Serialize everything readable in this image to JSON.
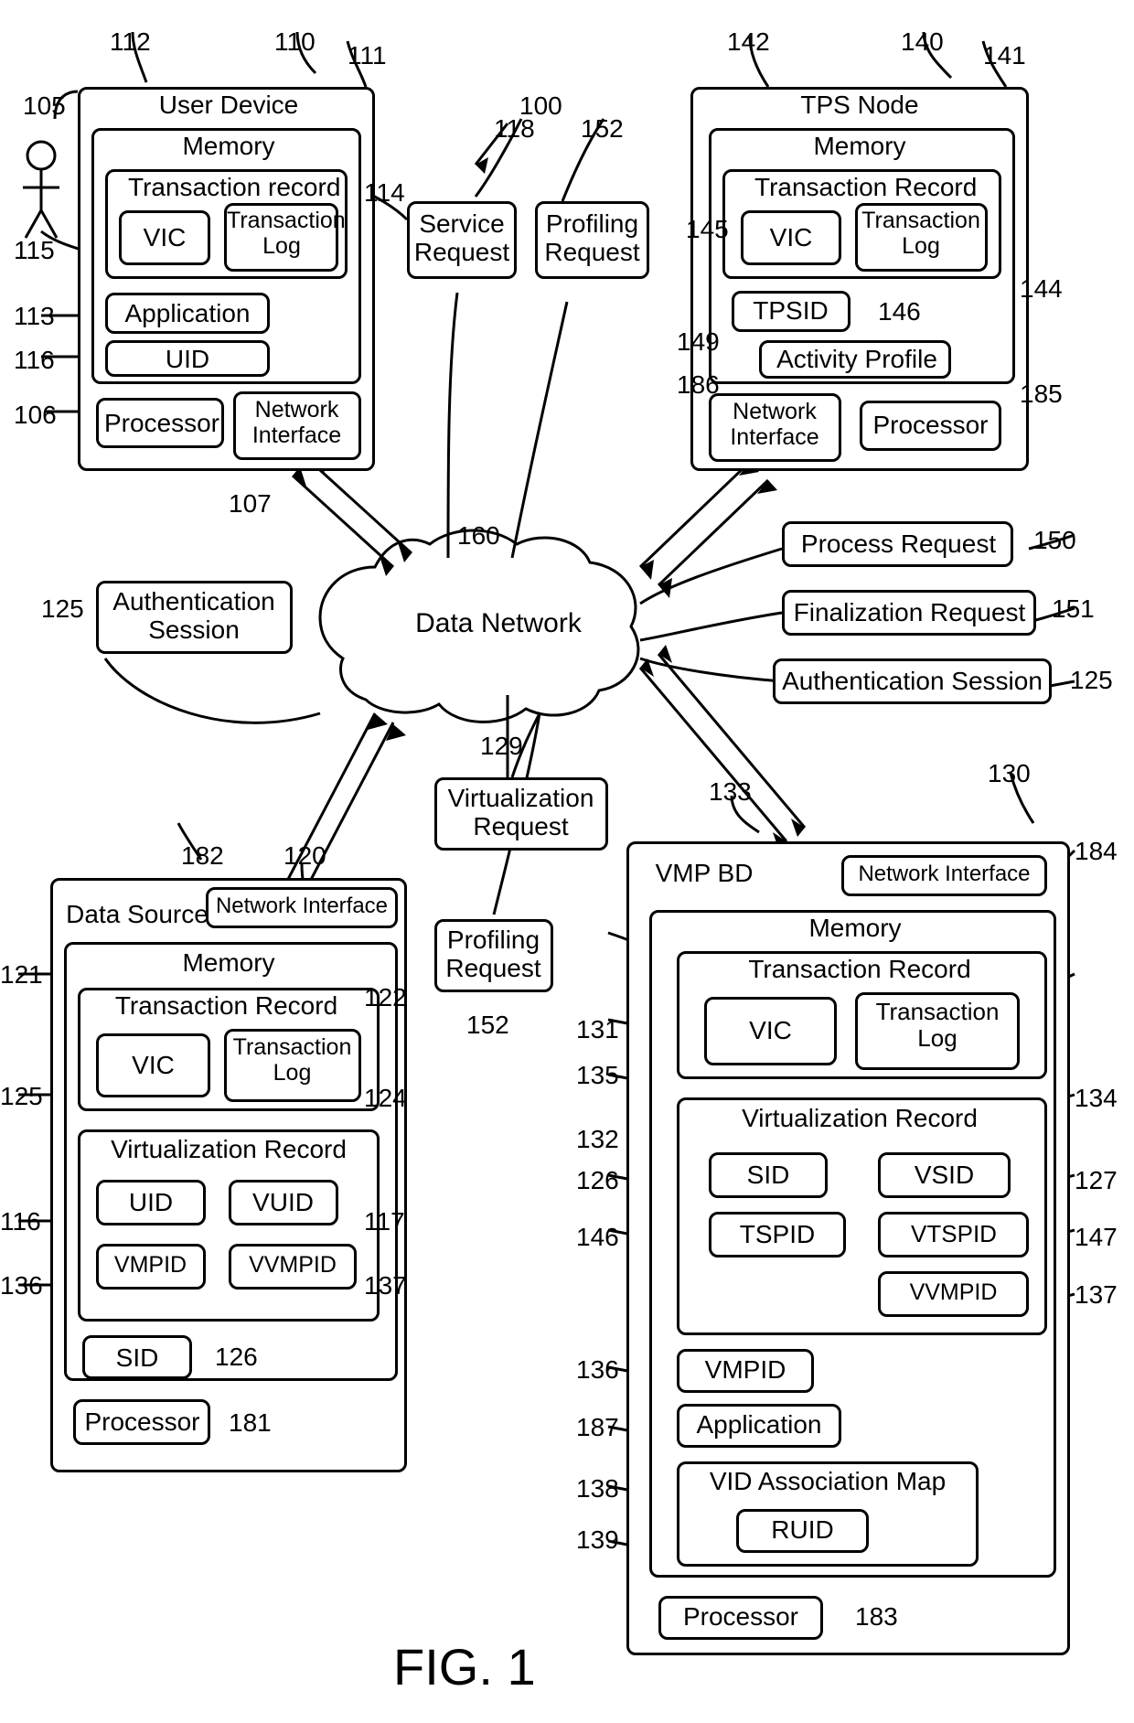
{
  "figure_label": "FIG. 1",
  "user_device": {
    "title": "User Device",
    "memory": "Memory",
    "tr": "Transaction record",
    "vic": "VIC",
    "tlog": "Transaction\nLog",
    "app": "Application",
    "uid": "UID",
    "proc": "Processor",
    "netif": "Network\nInterface"
  },
  "tps_node": {
    "title": "TPS Node",
    "memory": "Memory",
    "tr": "Transaction Record",
    "vic": "VIC",
    "tlog": "Transaction\nLog",
    "tpsid": "TPSID",
    "activity": "Activity Profile",
    "netif": "Network\nInterface",
    "proc": "Processor"
  },
  "data_source": {
    "title": "Data Source",
    "netif": "Network Interface",
    "memory": "Memory",
    "tr": "Transaction Record",
    "vic": "VIC",
    "tlog": "Transaction\nLog",
    "vr": "Virtualization Record",
    "uid": "UID",
    "vuid": "VUID",
    "vmpid": "VMPID",
    "vvmpid": "VVMPID",
    "sid": "SID",
    "proc": "Processor"
  },
  "vmp_bd": {
    "title": "VMP BD",
    "netif": "Network Interface",
    "memory": "Memory",
    "tr": "Transaction Record",
    "vic": "VIC",
    "tlog": "Transaction\nLog",
    "vr": "Virtualization Record",
    "sid": "SID",
    "vsid": "VSID",
    "tspid": "TSPID",
    "vtspid": "VTSPID",
    "vvmpid": "VVMPID",
    "vmpid": "VMPID",
    "app": "Application",
    "vidmap": "VID Association Map",
    "ruid": "RUID",
    "proc": "Processor"
  },
  "free": {
    "service_req": "Service\nRequest",
    "profiling_req": "Profiling\nRequest",
    "data_network": "Data Network",
    "auth_session": "Authentication\nSession",
    "virt_req": "Virtualization\nRequest",
    "profiling_req2": "Profiling\nRequest",
    "process_req": "Process Request",
    "final_req": "Finalization Request",
    "auth_session2": "Authentication Session"
  },
  "refs": {
    "r100": "100",
    "r105": "105",
    "r106": "106",
    "r107": "107",
    "r110": "110",
    "r111": "111",
    "r112": "112",
    "r113": "113",
    "r114": "114",
    "r115": "115",
    "r116": "116",
    "r117": "117",
    "r118": "118",
    "r120": "120",
    "r121": "121",
    "r122": "122",
    "r124": "124",
    "r125": "125",
    "r125b": "125",
    "r125c": "125",
    "r126": "126",
    "r126b": "126",
    "r127": "127",
    "r129": "129",
    "r130": "130",
    "r131": "131",
    "r132": "132",
    "r133": "133",
    "r134": "134",
    "r135": "135",
    "r136": "136",
    "r136b": "136",
    "r137": "137",
    "r137b": "137",
    "r138": "138",
    "r139": "139",
    "r140": "140",
    "r141": "141",
    "r142": "142",
    "r144": "144",
    "r145": "145",
    "r146": "146",
    "r146b": "146",
    "r147": "147",
    "r149": "149",
    "r150": "150",
    "r151": "151",
    "r152": "152",
    "r152b": "152",
    "r160": "160",
    "r181": "181",
    "r182": "182",
    "r183": "183",
    "r184": "184",
    "r185": "185",
    "r186": "186",
    "r187": "187"
  }
}
